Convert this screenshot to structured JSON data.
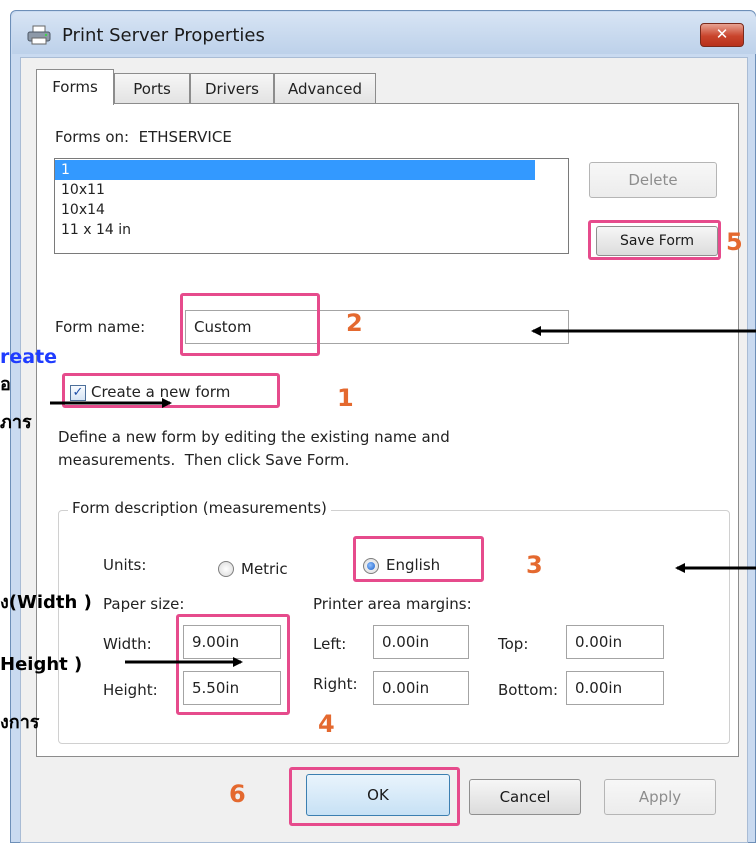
{
  "window": {
    "title": "Print Server Properties",
    "close_glyph": "✕"
  },
  "tabs": [
    {
      "label": "Forms",
      "active": true
    },
    {
      "label": "Ports",
      "active": false
    },
    {
      "label": "Drivers",
      "active": false
    },
    {
      "label": "Advanced",
      "active": false
    }
  ],
  "forms_on_label": "Forms on:  ETHSERVICE",
  "form_list": {
    "items": [
      "1",
      "10x11",
      "10x14",
      "11 x 14 in"
    ],
    "selected_index": 0
  },
  "buttons": {
    "delete": "Delete",
    "save_form": "Save Form",
    "ok": "OK",
    "cancel": "Cancel",
    "apply": "Apply"
  },
  "form_name": {
    "label": "Form name:",
    "value": "Custom"
  },
  "create_new_form": {
    "label": "Create a new form",
    "checked": true
  },
  "description_line1": "Define a new form by editing the existing name and",
  "description_line2": "measurements.  Then click Save Form.",
  "form_description": {
    "title": "Form description (measurements)",
    "units_label": "Units:",
    "metric_label": "Metric",
    "english_label": "English",
    "selected_unit": "English",
    "paper_size_label": "Paper size:",
    "width_label": "Width:",
    "width_value": "9.00in",
    "height_label": "Height:",
    "height_value": "5.50in",
    "margins_label": "Printer area margins:",
    "left_label": "Left:",
    "left_value": "0.00in",
    "right_label": "Right:",
    "right_value": "0.00in",
    "top_label": "Top:",
    "top_value": "0.00in",
    "bottom_label": "Bottom:",
    "bottom_value": "0.00in"
  },
  "annotations": {
    "step1": "1",
    "step2": "2",
    "step3": "3",
    "step4": "4",
    "step5": "5",
    "step6": "6",
    "highlight_color": "#e64b8c",
    "number_color": "#e4692f",
    "side_create": "reate",
    "side_1": "ื่อ",
    "side_2": "ภาร",
    "side_width": "ง(Width )",
    "side_height": "Height )",
    "side_3": "งการ",
    "side_create_color": "#1f3cff"
  },
  "icons": {
    "title": "printer-icon",
    "close": "close-icon",
    "scroll_up": "scroll-up-icon",
    "scroll_down": "scroll-down-icon"
  }
}
